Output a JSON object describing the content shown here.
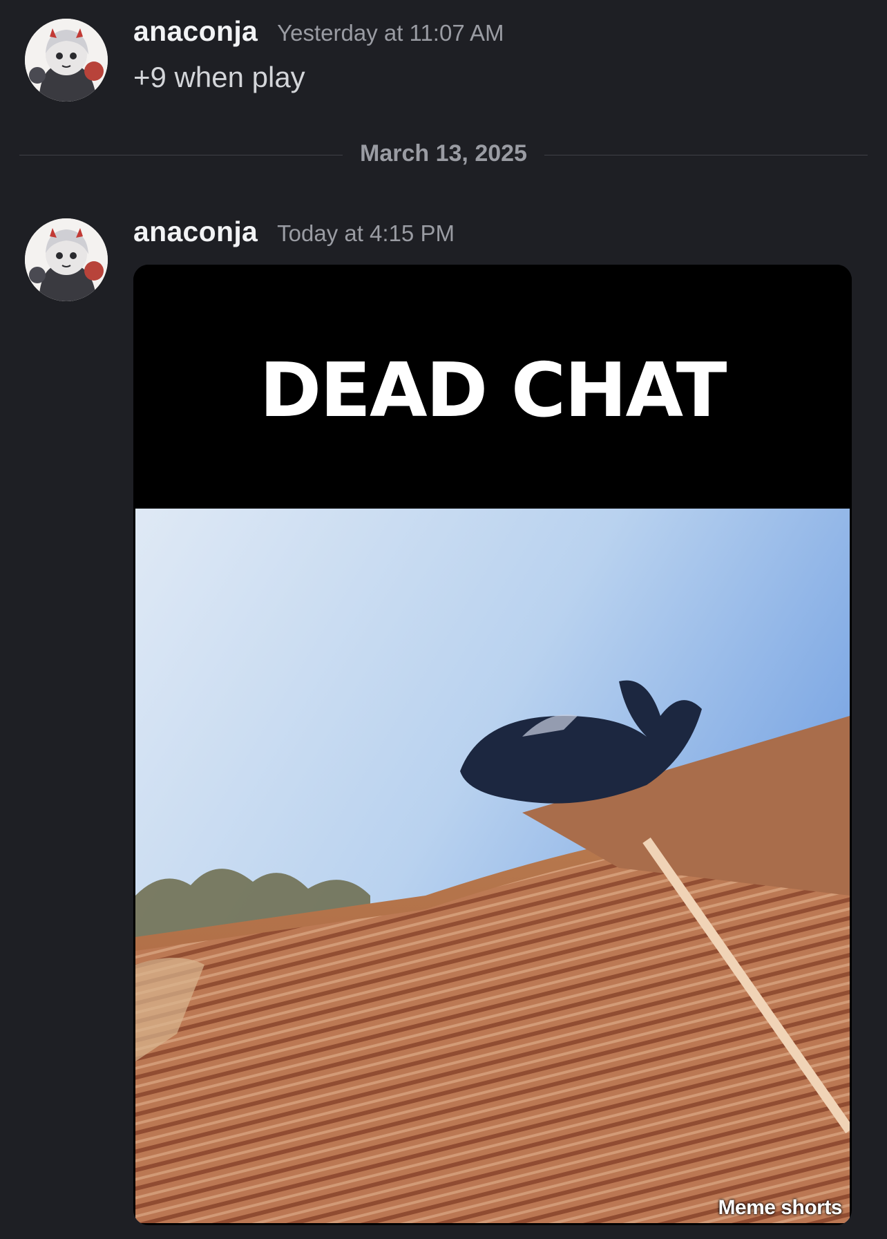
{
  "colors": {
    "background": "#1e1f24",
    "username": "#f2f3f5",
    "timestamp": "#9a9ca3",
    "message_text": "#d3d5d9",
    "divider": "#3f4147"
  },
  "messages": [
    {
      "username": "anaconja",
      "timestamp": "Yesterday at 11:07 AM",
      "text": "+9 when play",
      "avatar_icon": "anime-avatar-icon"
    },
    {
      "username": "anaconja",
      "timestamp": "Today at 4:15 PM",
      "avatar_icon": "anime-avatar-icon",
      "attachment": {
        "caption": "DEAD CHAT",
        "watermark": "Meme shorts"
      }
    }
  ],
  "divider": {
    "date": "March 13, 2025"
  }
}
